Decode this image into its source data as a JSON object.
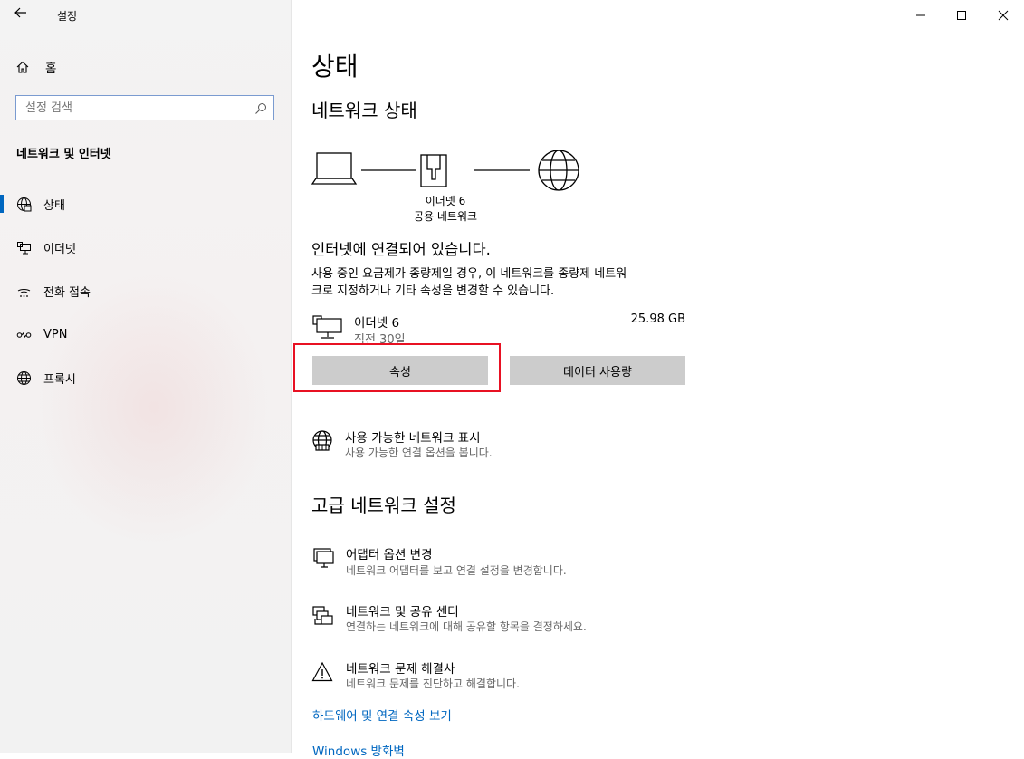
{
  "window": {
    "title": "설정",
    "back_icon": "back-arrow-icon",
    "controls": [
      "minimize",
      "maximize",
      "close"
    ]
  },
  "sidebar": {
    "home_label": "홈",
    "search_placeholder": "설정 검색",
    "section_title": "네트워크 및 인터넷",
    "items": [
      {
        "label": "상태",
        "icon": "globe-status-icon",
        "selected": true
      },
      {
        "label": "이더넷",
        "icon": "ethernet-icon",
        "selected": false
      },
      {
        "label": "전화 접속",
        "icon": "dialup-icon",
        "selected": false
      },
      {
        "label": "VPN",
        "icon": "vpn-icon",
        "selected": false
      },
      {
        "label": "프록시",
        "icon": "globe-icon",
        "selected": false
      }
    ]
  },
  "main": {
    "page_title": "상태",
    "network_status_title": "네트워크 상태",
    "diagram": {
      "adapter_name": "이더넷 6",
      "network_type": "공용 네트워크"
    },
    "connected_text": "인터넷에 연결되어 있습니다.",
    "metered_text_line1": "사용 중인 요금제가 종량제일 경우, 이 네트워크를 종량제 네트워",
    "metered_text_line2": "크로 지정하거나 기타 속성을 변경할 수 있습니다.",
    "connection": {
      "name": "이더넷 6",
      "subtitle": "직전 30일",
      "usage": "25.98 GB"
    },
    "buttons": {
      "properties": "속성",
      "data_usage": "데이터 사용량"
    },
    "show_networks": {
      "title": "사용 가능한 네트워크 표시",
      "subtitle": "사용 가능한 연결 옵션을 봅니다."
    },
    "advanced_title": "고급 네트워크 설정",
    "advanced_items": [
      {
        "title": "어댑터 옵션 변경",
        "subtitle": "네트워크 어댑터를 보고 연결 설정을 변경합니다.",
        "icon": "adapter-icon"
      },
      {
        "title": "네트워크 및 공유 센터",
        "subtitle": "연결하는 네트워크에 대해 공유할 항목을 결정하세요.",
        "icon": "sharing-center-icon"
      },
      {
        "title": "네트워크 문제 해결사",
        "subtitle": "네트워크 문제를 진단하고 해결합니다.",
        "icon": "warning-icon"
      }
    ],
    "links": {
      "hardware": "하드웨어 및 연결 속성 보기",
      "firewall": "Windows 방화벽"
    }
  },
  "colors": {
    "accent": "#0067c0",
    "highlight_box": "#e81123",
    "button_bg": "#cccccc",
    "sidebar_bg": "#f3f3f3"
  }
}
